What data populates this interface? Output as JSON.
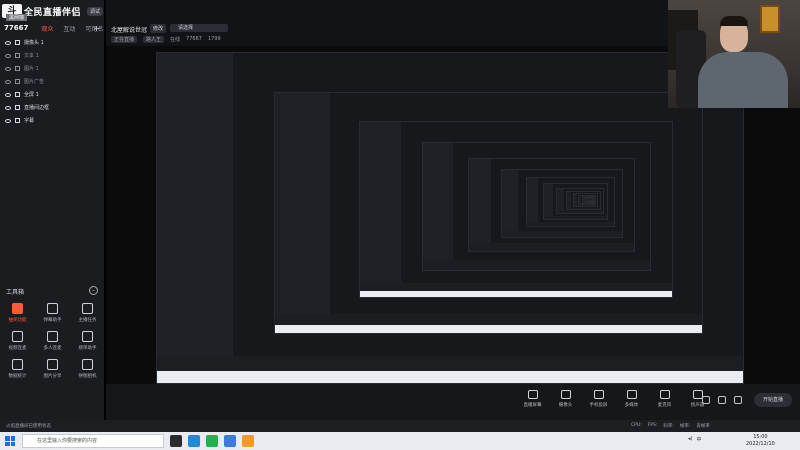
{
  "app": {
    "logo_mark": "斗",
    "logo_text": "全民直播伴侣",
    "logo_badge": "调试",
    "name_tag": "黑网咖"
  },
  "sidebar": {
    "stats": {
      "id": "77667",
      "tabs": [
        "观众",
        "互动",
        "可用名"
      ]
    },
    "plus": "+",
    "scenes": [
      {
        "label": "摄像头 1",
        "bright": true
      },
      {
        "label": "文本 1",
        "bright": false
      },
      {
        "label": "图片 1",
        "bright": false
      },
      {
        "label": "图片广告",
        "bright": false
      },
      {
        "label": "全屏 1",
        "bright": true
      },
      {
        "label": "直播间边框",
        "bright": true
      },
      {
        "label": "字幕",
        "bright": true
      }
    ],
    "toolbox_title": "工具箱",
    "tools": [
      {
        "label": "抽奖功能",
        "hot": true
      },
      {
        "label": "弹幕助手",
        "hot": false
      },
      {
        "label": "主播任务",
        "hot": false
      },
      {
        "label": "视频连麦",
        "hot": false
      },
      {
        "label": "多人连麦",
        "hot": false
      },
      {
        "label": "榜单助手",
        "hot": false
      },
      {
        "label": "数据统计",
        "hot": false
      },
      {
        "label": "图片分享",
        "hot": false
      },
      {
        "label": "拼图相机",
        "hot": false
      }
    ]
  },
  "main": {
    "room_title": "北屋解说世冠",
    "room_edit": "修改",
    "room_field": "请选择",
    "sub": [
      "正在直播",
      "路人王",
      "在线",
      "77667",
      "1799"
    ]
  },
  "controls": {
    "buttons": [
      "直播屏幕",
      "摄像头",
      "手机投屏",
      "多媒体",
      "麦克风",
      "扬声器"
    ],
    "start": "开始直播"
  },
  "statusline": {
    "left": "火焰直播间已使用状态",
    "right": [
      "CPU:",
      "FPS:",
      "码率:",
      "帧率:",
      "丢帧率"
    ]
  },
  "taskbar": {
    "search_placeholder": "在这里输入你要搜索的内容",
    "time": "15:00",
    "date": "2022/12/10",
    "tray_lang": "中"
  }
}
